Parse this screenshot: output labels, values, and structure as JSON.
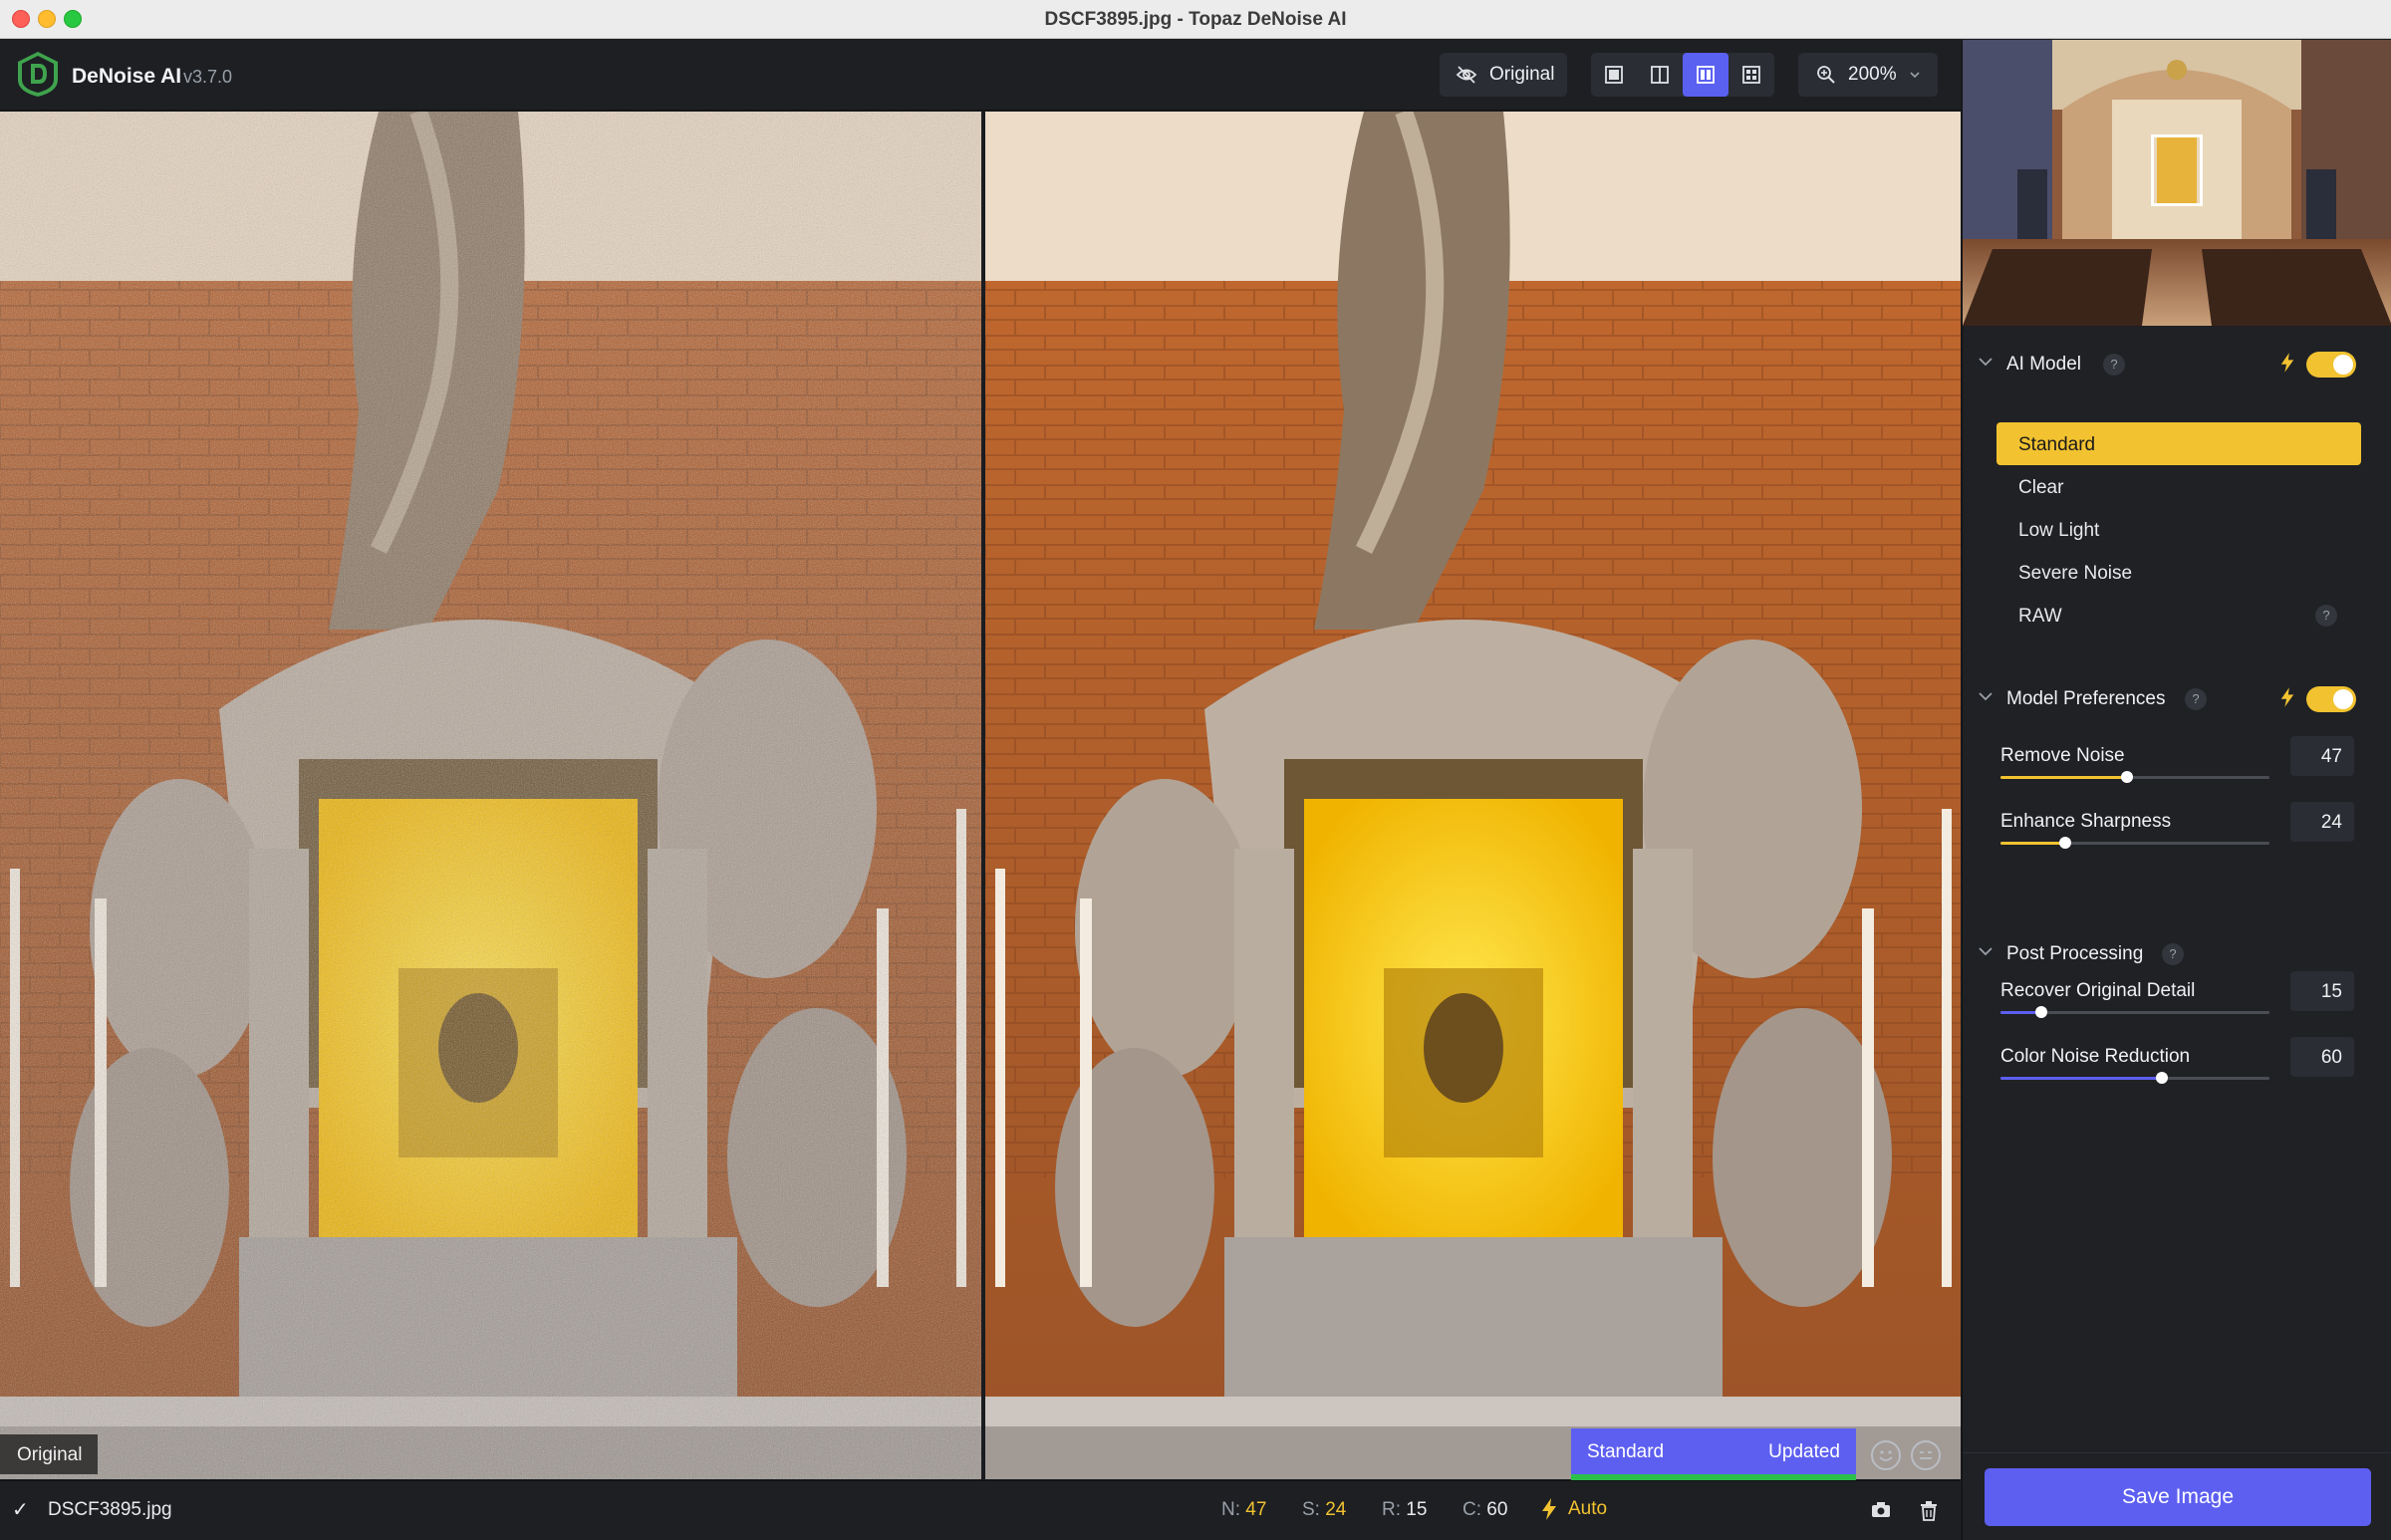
{
  "window": {
    "title": "DSCF3895.jpg - Topaz DeNoise AI"
  },
  "toolbar": {
    "app_name": "DeNoise AI",
    "version": "v3.7.0",
    "original_label": "Original",
    "zoom_label": "200%",
    "view_modes": [
      "single-view-icon",
      "split-view-icon",
      "side-by-side-icon",
      "grid-view-icon"
    ],
    "active_view": "side-by-side-icon"
  },
  "preview": {
    "left_label": "Original",
    "model_label": "Standard",
    "model_status": "Updated",
    "progress": 1.0
  },
  "status": {
    "filename": "DSCF3895.jpg",
    "stats": [
      {
        "key": "N:",
        "value": "47",
        "highlight": true
      },
      {
        "key": "S:",
        "value": "24",
        "highlight": true
      },
      {
        "key": "R:",
        "value": "15",
        "highlight": false
      },
      {
        "key": "C:",
        "value": "60",
        "highlight": false
      }
    ],
    "auto_label": "Auto"
  },
  "sidebar": {
    "ai_model": {
      "title": "AI Model",
      "enabled": true,
      "models": [
        {
          "label": "Standard",
          "active": true,
          "help": false
        },
        {
          "label": "Clear",
          "active": false,
          "help": false
        },
        {
          "label": "Low Light",
          "active": false,
          "help": false
        },
        {
          "label": "Severe Noise",
          "active": false,
          "help": false
        },
        {
          "label": "RAW",
          "active": false,
          "help": true
        }
      ]
    },
    "model_preferences": {
      "title": "Model Preferences",
      "enabled": true,
      "sliders": [
        {
          "label": "Remove Noise",
          "value": 47,
          "display": "47",
          "color": "#f2c230"
        },
        {
          "label": "Enhance Sharpness",
          "value": 24,
          "display": "24",
          "color": "#f2c230"
        }
      ]
    },
    "post_processing": {
      "title": "Post Processing",
      "sliders": [
        {
          "label": "Recover Original Detail",
          "value": 15,
          "display": "15",
          "color": "#5d5ff0"
        },
        {
          "label": "Color Noise Reduction",
          "value": 60,
          "display": "60",
          "color": "#5d5ff0"
        }
      ]
    },
    "save_label": "Save Image",
    "help_glyph": "?"
  },
  "colors": {
    "accent": "#5d5ff0",
    "highlight": "#f2c230",
    "success": "#2bc04a"
  }
}
